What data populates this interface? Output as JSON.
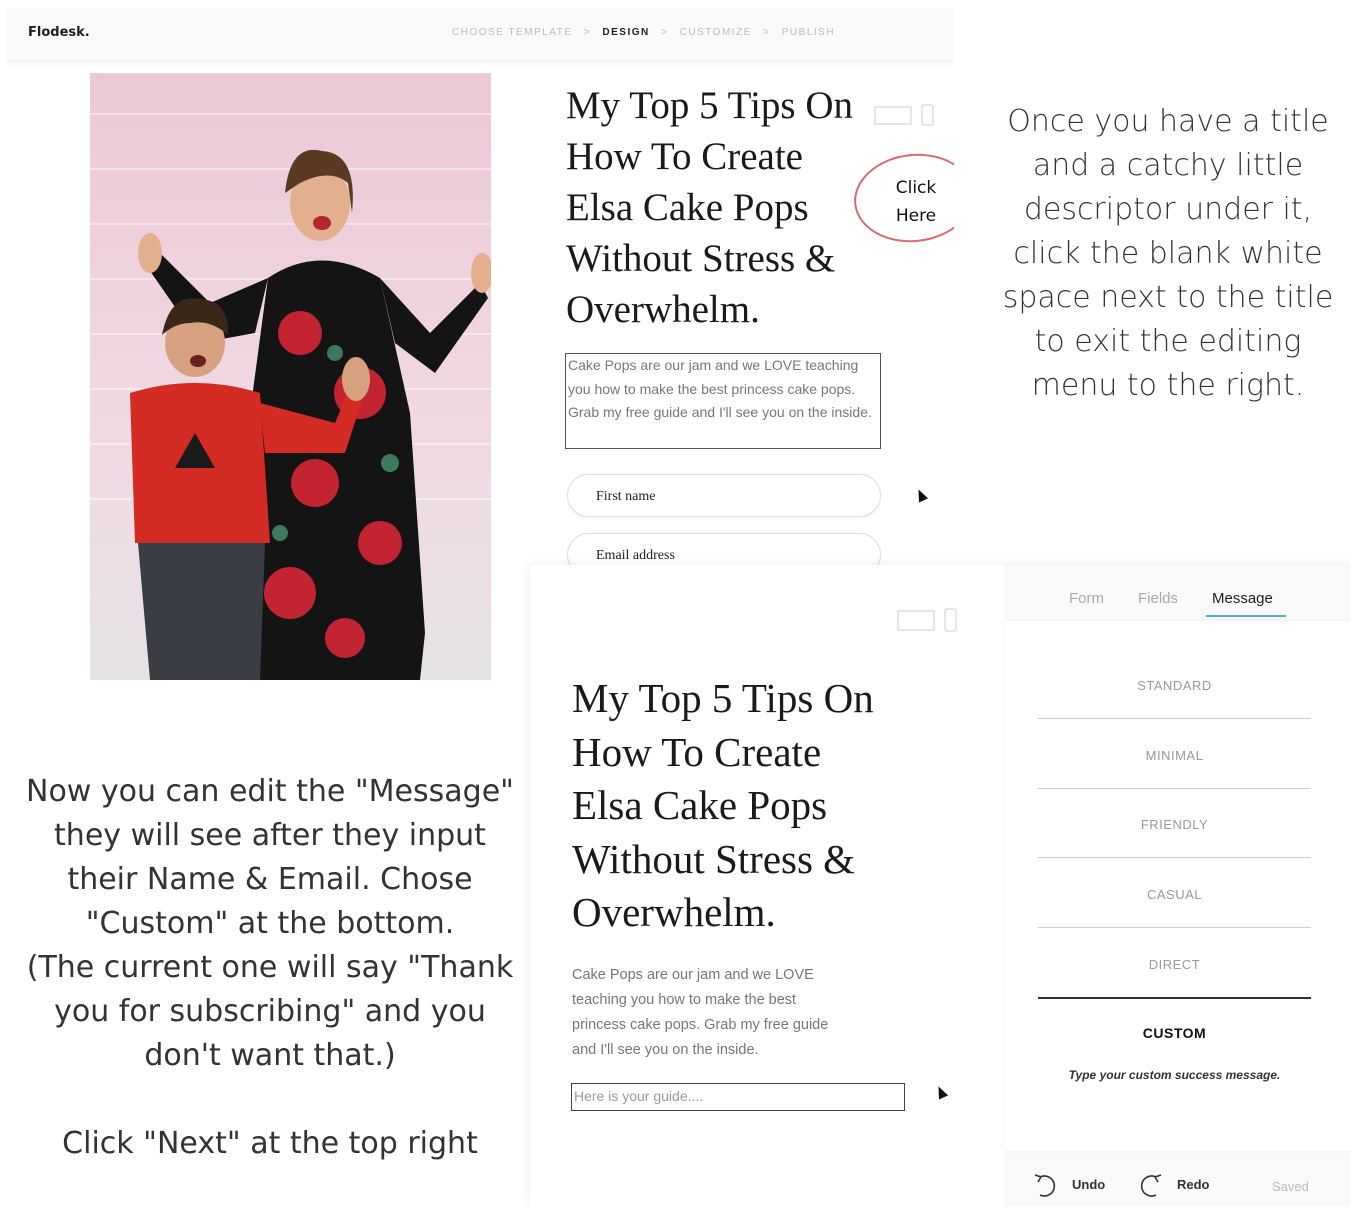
{
  "shot1": {
    "logo": "Flodesk.",
    "steps": [
      "CHOOSE TEMPLATE",
      ">",
      "DESIGN",
      ">",
      "CUSTOMIZE",
      ">",
      "PUBLISH"
    ],
    "title_lines": [
      "My Top 5 Tips On",
      "How To Create",
      "Elsa Cake Pops",
      "Without Stress &",
      "Overwhelm."
    ],
    "description": "Cake Pops are our jam and we LOVE teaching you how to make the best princess cake pops.  Grab my free guide and I'll see you on the inside.",
    "first_name_placeholder": "First name",
    "email_placeholder": "Email address",
    "click_here": [
      "Click",
      "Here"
    ]
  },
  "instruction_right": "Once you have a title and a catchy little descriptor under it, click the blank white space next to the title to exit the editing menu to the right.",
  "instruction_left": [
    "Now you can edit the \"Message\" they will see after they input their Name & Email. Chose \"Custom\" at the bottom.",
    "(The current one will say \"Thank you for subscribing\" and you don't want that.)",
    "",
    "Click \"Next\" at the top right"
  ],
  "shot2": {
    "tabs": [
      "Form",
      "Fields",
      "Message"
    ],
    "active_tab": "Message",
    "title_lines": [
      "My Top 5 Tips On",
      "How To Create",
      "Elsa Cake Pops",
      "Without Stress &",
      "Overwhelm."
    ],
    "description_lines": [
      "Cake Pops are our jam and we LOVE",
      "teaching you how to make the best",
      "princess cake pops.  Grab my free guide",
      "and I'll see you on the inside."
    ],
    "guide_input": "Here is your guide....",
    "message_options": [
      "STANDARD",
      "MINIMAL",
      "FRIENDLY",
      "CASUAL",
      "DIRECT",
      "CUSTOM"
    ],
    "selected_option": "CUSTOM",
    "custom_message_hint": "Type your custom success message.",
    "undo": "Undo",
    "redo": "Redo",
    "saved": "Saved"
  },
  "colors": {
    "accent_tab": "#5aa8d6",
    "click_circle": "#d96a72"
  },
  "icons": [
    "desktop-icon",
    "mobile-icon",
    "cursor-icon",
    "undo-icon",
    "redo-icon"
  ]
}
